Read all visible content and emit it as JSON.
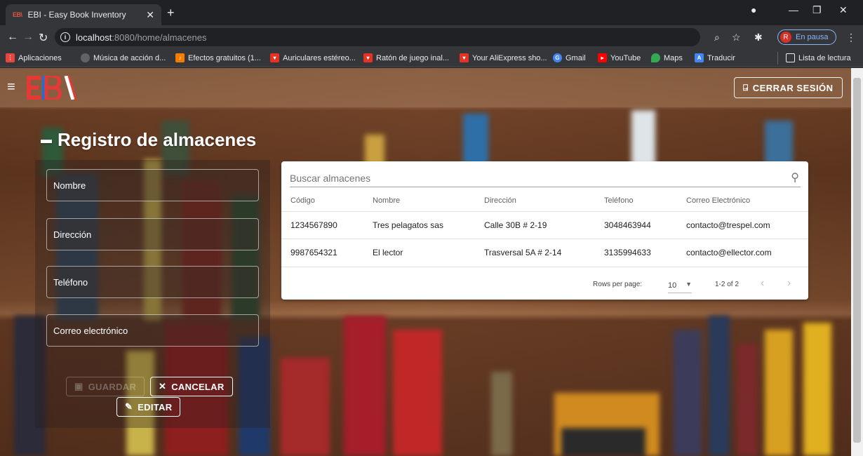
{
  "browser": {
    "tab_title": "EBI - Easy Book Inventory",
    "tab_favicon": "EB\\",
    "url_host": "localhost",
    "url_path": ":8080/home/almacenes",
    "profile_initial": "R",
    "profile_status": "En pausa",
    "bookmarks": [
      {
        "label": "Aplicaciones",
        "icon": "apps-grid-icon",
        "color": "#e8453c"
      },
      {
        "label": "Música de acción d...",
        "icon": "globe-icon",
        "color": "#5f6368"
      },
      {
        "label": "Efectos gratuitos (1...",
        "icon": "music-icon",
        "color": "#f57c00"
      },
      {
        "label": "Auriculares estéreo...",
        "icon": "aliexpress-icon",
        "color": "#e43225"
      },
      {
        "label": "Ratón de juego inal...",
        "icon": "aliexpress-icon",
        "color": "#e43225"
      },
      {
        "label": "Your AliExpress sho...",
        "icon": "aliexpress-icon",
        "color": "#e43225"
      },
      {
        "label": "Gmail",
        "icon": "google-icon",
        "color": "#4285f4"
      },
      {
        "label": "YouTube",
        "icon": "youtube-icon",
        "color": "#ff0000"
      },
      {
        "label": "Maps",
        "icon": "maps-pin-icon",
        "color": "#34a853"
      },
      {
        "label": "Traducir",
        "icon": "translate-icon",
        "color": "#4285f4"
      }
    ],
    "reading_list": "Lista de lectura"
  },
  "app": {
    "logout_label": "CERRAR SESIÓN",
    "title": "Registro de almacenes",
    "form": {
      "fields": [
        "Nombre",
        "Dirección",
        "Teléfono",
        "Correo electrónico"
      ],
      "save_label": "GUARDAR",
      "cancel_label": "CANCELAR",
      "edit_label": "EDITAR"
    },
    "table": {
      "search_placeholder": "Buscar almacenes",
      "columns": [
        "Código",
        "Nombre",
        "Dirección",
        "Teléfono",
        "Correo Electrónico"
      ],
      "rows": [
        [
          "1234567890",
          "Tres pelagatos sas",
          "Calle 30B # 2-19",
          "3048463944",
          "contacto@trespel.com"
        ],
        [
          "9987654321",
          "El lector",
          "Trasversal 5A # 2-14",
          "3135994633",
          "contacto@ellector.com"
        ]
      ],
      "rows_per_page_label": "Rows per page:",
      "rows_per_page": "10",
      "range": "1-2 of 2"
    }
  }
}
